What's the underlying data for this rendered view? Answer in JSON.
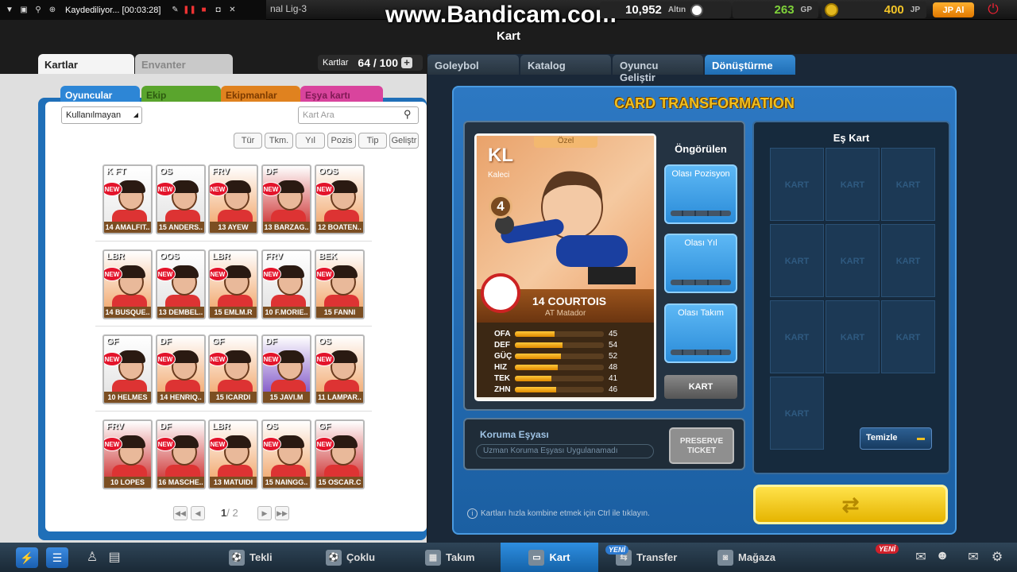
{
  "recorder": {
    "title": "Kaydediliyor... [00:03:28]"
  },
  "league": "nal Lig-3",
  "watermark": "www.Bandicam.com",
  "currency": {
    "altin_value": "10,952",
    "altin_label": "Altın",
    "gp_value": "263",
    "gp_label": "GP",
    "jp_value": "400",
    "jp_label": "JP",
    "jp_buy": "JP Al"
  },
  "screen_title": "Kart",
  "left": {
    "tabs": [
      "Kartlar",
      "Envanter"
    ],
    "cards_label": "Kartlar",
    "cards_count": "64 / 100",
    "category_tabs": [
      "Oyuncular",
      "Ekip",
      "Ekipmanlar",
      "Eşya kartı"
    ],
    "filter_value": "Kullanılmayan",
    "search_placeholder": "Kart Ara",
    "sort_buttons": [
      "Tür",
      "Tkm.",
      "Yıl",
      "Pozis",
      "Tip",
      "Geliştr"
    ],
    "new_badge": "NEW",
    "cards": [
      [
        {
          "pos": "K FT",
          "name": "14 AMALFIT..",
          "color": "#e8e8e8"
        },
        {
          "pos": "OS",
          "name": "15 ANDERS..",
          "color": "#e0e0e0"
        },
        {
          "pos": "FRV",
          "name": "13 AYEW",
          "color": "#f0a060"
        },
        {
          "pos": "DF",
          "name": "13 BARZAG..",
          "color": "#c82020"
        },
        {
          "pos": "OOS",
          "name": "12 BOATEN..",
          "color": "#f0a060"
        }
      ],
      [
        {
          "pos": "LBR",
          "name": "14 BUSQUE..",
          "color": "#f0a060"
        },
        {
          "pos": "OOS",
          "name": "13 DEMBEL..",
          "color": "#e0e0e0"
        },
        {
          "pos": "LBR",
          "name": "15 EMLM.R",
          "color": "#f0a060"
        },
        {
          "pos": "FRV",
          "name": "10 F.MORIE..",
          "color": "#e0e0e0"
        },
        {
          "pos": "BEK",
          "name": "15 FANNI",
          "color": "#f0a060"
        }
      ],
      [
        {
          "pos": "GF",
          "name": "10 HELMES",
          "color": "#e0e0e0"
        },
        {
          "pos": "DF",
          "name": "14 HENRIQ..",
          "color": "#f0a060"
        },
        {
          "pos": "GF",
          "name": "15 ICARDI",
          "color": "#f0a060"
        },
        {
          "pos": "DF",
          "name": "15 JAVI.M",
          "color": "#7040c0"
        },
        {
          "pos": "OS",
          "name": "11 LAMPAR..",
          "color": "#f0a060"
        }
      ],
      [
        {
          "pos": "FRV",
          "name": "10 LOPES",
          "color": "#c82020"
        },
        {
          "pos": "DF",
          "name": "16 MASCHE..",
          "color": "#c82020"
        },
        {
          "pos": "LBR",
          "name": "13 MATUIDI",
          "color": "#f0a060"
        },
        {
          "pos": "OS",
          "name": "15 NAINGG..",
          "color": "#f0a060"
        },
        {
          "pos": "GF",
          "name": "15 OSCAR.C",
          "color": "#c82020"
        }
      ]
    ],
    "page": "1",
    "page_total": "/ 2"
  },
  "right": {
    "tabs": [
      "Goleybol",
      "Katalog",
      "Oyuncu Geliştir",
      "Dönüştürme"
    ],
    "title": "CARD TRANSFORMATION",
    "main_card": {
      "pos": "KL",
      "pos_full": "Kaleci",
      "tag": "Özel",
      "ovr": "4",
      "name": "14 COURTOIS",
      "team": "AT Matador",
      "stats": [
        {
          "l": "OFA",
          "v": 45
        },
        {
          "l": "DEF",
          "v": 54
        },
        {
          "l": "GÜÇ",
          "v": 52
        },
        {
          "l": "HIZ",
          "v": 48
        },
        {
          "l": "TEK",
          "v": 41
        },
        {
          "l": "ZHN",
          "v": 46
        }
      ]
    },
    "predicted_title": "Öngörülen",
    "predicted": [
      "Olası Pozisyon",
      "Olası Yıl",
      "Olası Takım"
    ],
    "kart_button": "KART",
    "protection_title": "Koruma Eşyası",
    "protection_value": "Uzman Koruma Eşyası Uygulanamadı",
    "preserve_ticket": "PRESERVE TICKET",
    "match_title": "Eş Kart",
    "slot_label": "KART",
    "clear_button": "Temizle",
    "hint": "Kartları hızla kombine etmek için Ctrl ile tıklayın."
  },
  "bottom_nav": {
    "items": [
      "Tekli",
      "Çoklu",
      "Takım",
      "Kart",
      "Transfer",
      "Mağaza"
    ],
    "new_badge": "YENİ",
    "transfer_badge": "YENİ"
  }
}
